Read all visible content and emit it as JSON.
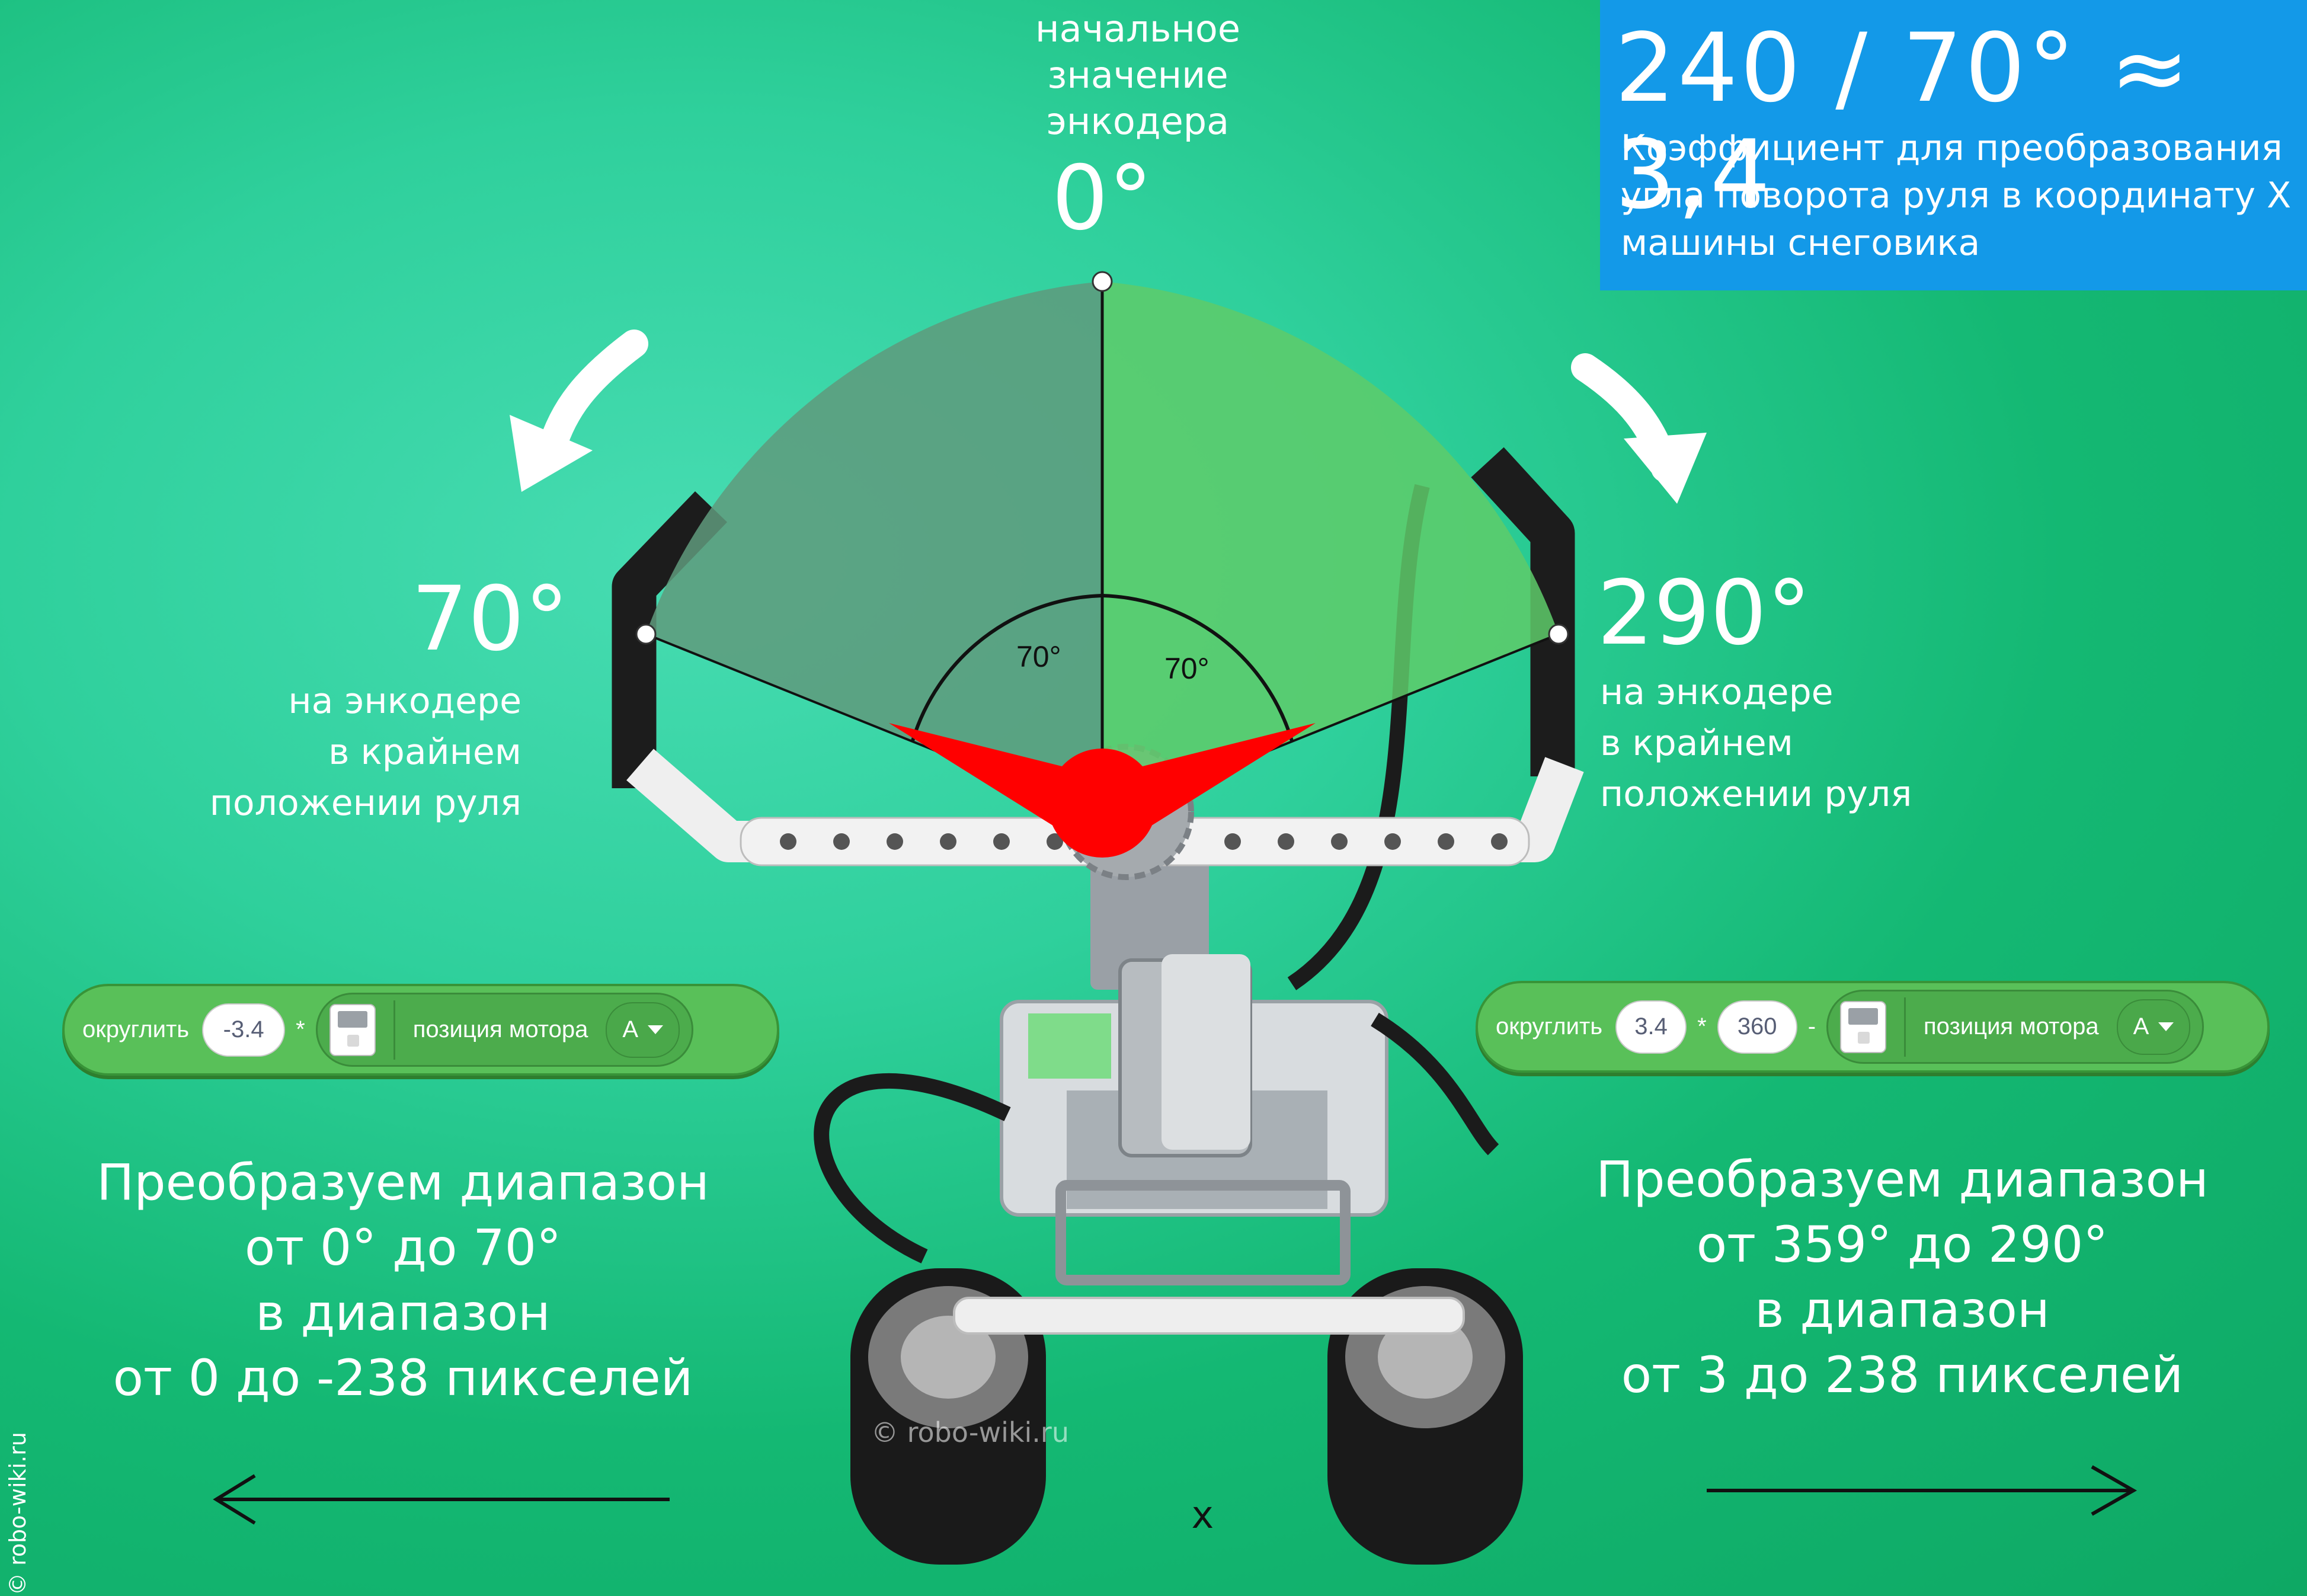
{
  "header": {
    "start_label_lines": [
      "начальное",
      "значение",
      "энкодера"
    ],
    "zero_angle": "0°"
  },
  "info_box": {
    "formula": "240 / 70° ≈ 3,4",
    "description_lines": [
      "Коэффициент для преобразования",
      "угла поворота руля в координату X",
      "машины снеговика"
    ],
    "color": "#1399e8"
  },
  "left_side": {
    "angle": "70°",
    "desc_lines": [
      "на энкодере",
      "в крайнем",
      "положении руля"
    ],
    "sector_label": "70°"
  },
  "right_side": {
    "angle": "290°",
    "desc_lines": [
      "на энкодере",
      "в крайнем",
      "положении руля"
    ],
    "sector_label": "70°"
  },
  "block_left": {
    "round_label": "округлить",
    "value": "-3.4",
    "op": "*",
    "motor_label": "позиция мотора",
    "port": "A"
  },
  "block_right": {
    "round_label": "округлить",
    "value": "3.4",
    "op1": "*",
    "value2": "360",
    "op2": "-",
    "motor_label": "позиция мотора",
    "port": "A"
  },
  "left_caption_lines": [
    "Преобразуем диапазон",
    "от 0° до 70°",
    "в диапазон",
    "от 0 до -238 пикселей"
  ],
  "right_caption_lines": [
    "Преобразуем диапазон",
    "от 359° до 290°",
    "в диапазон",
    "от 3 до 238 пикселей"
  ],
  "x_axis_label": "x",
  "watermark": "© robo-wiki.ru",
  "copyright_vertical": "© robo-wiki.ru",
  "colors": {
    "left_sector": "#5f9a7c",
    "right_sector": "#5ecb6a",
    "needle": "#ff0000",
    "block_green": "#59c059"
  }
}
